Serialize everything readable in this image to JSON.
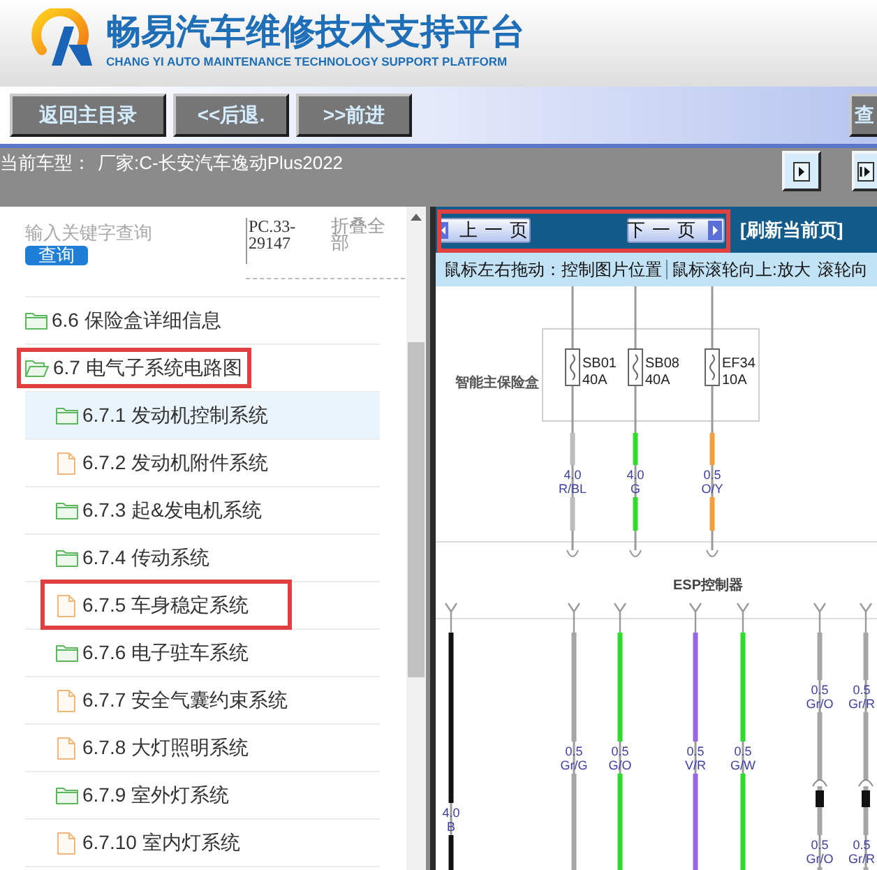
{
  "header": {
    "title": "畅易汽车维修技术支持平台",
    "subtitle": "CHANG YI AUTO MAINTENANCE TECHNOLOGY SUPPORT PLATFORM"
  },
  "toolbar": {
    "buttons": [
      "返回主目录",
      "<<后退.",
      ">>前进",
      "查"
    ]
  },
  "vehicle": {
    "label": "当前车型：",
    "value": "厂家:C-长安汽车逸动Plus2022"
  },
  "sidebar": {
    "search": {
      "placeholder": "输入关键字查询",
      "button": "查询"
    },
    "code": "PC.33-29147",
    "collapse_all": "折叠全部",
    "items": [
      {
        "kind": "folder",
        "label": "6.6 保险盒详细信息",
        "selected": false,
        "expanded": false,
        "annotated": false
      },
      {
        "kind": "folder",
        "label": "6.7 电气子系统电路图",
        "selected": false,
        "expanded": true,
        "annotated": true,
        "children": [
          {
            "kind": "folder",
            "label": "6.7.1 发动机控制系统",
            "selected": true,
            "expanded": false,
            "annotated": false
          },
          {
            "kind": "page",
            "label": "6.7.2 发动机附件系统",
            "selected": false,
            "annotated": false
          },
          {
            "kind": "folder",
            "label": "6.7.3 起&发电机系统",
            "selected": false,
            "expanded": false,
            "annotated": false
          },
          {
            "kind": "folder",
            "label": "6.7.4 传动系统",
            "selected": false,
            "expanded": false,
            "annotated": false
          },
          {
            "kind": "page",
            "label": "6.7.5 车身稳定系统",
            "selected": false,
            "annotated": true
          },
          {
            "kind": "folder",
            "label": "6.7.6 电子驻车系统",
            "selected": false,
            "expanded": false,
            "annotated": false
          },
          {
            "kind": "page",
            "label": "6.7.7 安全气囊约束系统",
            "selected": false,
            "annotated": false
          },
          {
            "kind": "page",
            "label": "6.7.8 大灯照明系统",
            "selected": false,
            "annotated": false
          },
          {
            "kind": "folder",
            "label": "6.7.9 室外灯系统",
            "selected": false,
            "expanded": false,
            "annotated": false
          },
          {
            "kind": "page",
            "label": "6.7.10 室内灯系统",
            "selected": false,
            "annotated": false
          }
        ]
      }
    ]
  },
  "viewer": {
    "page_nav": {
      "prev": "上一页",
      "next": "下一页",
      "annotated": true
    },
    "refresh": "[刷新当前页]",
    "hints": [
      "鼠标左右拖动：控制图片位置",
      "鼠标滚轮向上:放大",
      "滚轮向"
    ],
    "diagram": {
      "fuse_box_label": "智能主保险盒",
      "fuses": [
        {
          "name": "SB01",
          "rating": "40A"
        },
        {
          "name": "SB08",
          "rating": "40A"
        },
        {
          "name": "EF34",
          "rating": "10A"
        }
      ],
      "fuse_wires": [
        {
          "color": "#bdbdbd",
          "labels": [
            {
              "size": "4.0",
              "code": "R/BL"
            }
          ]
        },
        {
          "color": "#2edc2e",
          "labels": [
            {
              "size": "4.0",
              "code": "G"
            }
          ]
        },
        {
          "color": "#f0a040",
          "labels": [
            {
              "size": "0.5",
              "code": "O/Y"
            }
          ]
        }
      ],
      "module_label": "ESP控制器",
      "module_wires": [
        {
          "color": "#111111",
          "connector": false,
          "labels": [
            {
              "size": "4.0",
              "code": "B"
            }
          ]
        },
        {
          "color": "#a6a6a6",
          "connector": false,
          "labels": [
            {
              "size": "0.5",
              "code": "Gr/G"
            }
          ]
        },
        {
          "color": "#2edc2e",
          "connector": false,
          "labels": [
            {
              "size": "0.5",
              "code": "G/O"
            }
          ]
        },
        {
          "color": "#9a66e8",
          "connector": false,
          "labels": [
            {
              "size": "0.5",
              "code": "V/R"
            }
          ]
        },
        {
          "color": "#2edc2e",
          "connector": false,
          "labels": [
            {
              "size": "0.5",
              "code": "G/W"
            }
          ]
        },
        {
          "color": "#a6a6a6",
          "connector": true,
          "labels": [
            {
              "size": "0.5",
              "code": "Gr/O"
            },
            {
              "size": "0.5",
              "code": "Gr/O"
            }
          ]
        },
        {
          "color": "#a6a6a6",
          "connector": true,
          "labels": [
            {
              "size": "0.5",
              "code": "Gr/R"
            },
            {
              "size": "0.5",
              "code": "Gr/R"
            }
          ]
        }
      ]
    }
  }
}
